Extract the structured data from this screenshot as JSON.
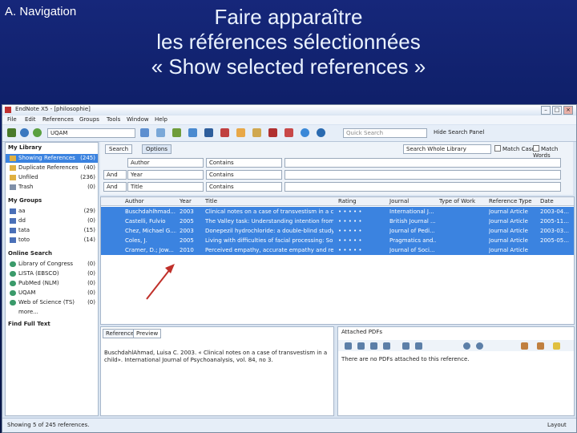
{
  "slide": {
    "section_label": "A. Navigation",
    "title_lines": [
      "Faire apparaître",
      "les références sélectionnées",
      "« Show selected references »"
    ]
  },
  "window": {
    "title": "EndNote X5 - [philosophie]",
    "buttons": [
      "–",
      "□",
      "×"
    ],
    "menu": [
      "File",
      "Edit",
      "References",
      "Groups",
      "Tools",
      "Window",
      "Help"
    ],
    "toolbar": {
      "style_value": "UQAM",
      "group_value": "UQAM",
      "quick_search_placeholder": "Quick Search",
      "hide_search_label": "Hide Search Panel"
    },
    "library": {
      "header": "My Library",
      "items": [
        {
          "label": "Showing References",
          "count": "(245)",
          "selected": true
        },
        {
          "label": "Duplicate References",
          "count": "(40)",
          "selected": false
        },
        {
          "label": "Unfiled",
          "count": "(236)",
          "selected": false
        },
        {
          "label": "Trash",
          "count": "(0)",
          "selected": false
        }
      ],
      "groups_header": "My Groups",
      "groups": [
        {
          "label": "aa",
          "count": "(29)"
        },
        {
          "label": "dd",
          "count": "(0)"
        },
        {
          "label": "tata",
          "count": "(15)"
        },
        {
          "label": "toto",
          "count": "(14)"
        }
      ],
      "online_header": "Online Search",
      "online": [
        {
          "label": "Library of Congress",
          "count": "(0)"
        },
        {
          "label": "LISTA (EBSCO)",
          "count": "(0)"
        },
        {
          "label": "PubMed (NLM)",
          "count": "(0)"
        },
        {
          "label": "UQAM",
          "count": "(0)"
        },
        {
          "label": "Web of Science (TS)",
          "count": "(0)"
        }
      ],
      "more_label": "more...",
      "fulltext_header": "Find Full Text"
    },
    "search": {
      "tabs": [
        "Search",
        "Options"
      ],
      "search_whole": "Search Whole Library",
      "match_case": "Match Case",
      "match_words": "Match Words",
      "rows": [
        {
          "bool": "",
          "field": "Author",
          "op": "Contains"
        },
        {
          "bool": "And",
          "field": "Year",
          "op": "Contains"
        },
        {
          "bool": "And",
          "field": "Title",
          "op": "Contains"
        }
      ]
    },
    "references": {
      "columns": [
        "Author",
        "Year",
        "Title",
        "Rating",
        "Journal",
        "Type of Work",
        "Reference Type",
        "Date"
      ],
      "rows": [
        {
          "author": "Buschdahlhmad...",
          "year": "2003",
          "title": "Clinical notes on a case of transvestism in a child",
          "rating": "• • • • •",
          "journal": "International J...",
          "type": "",
          "reftype": "Journal Article",
          "date": "2003-04..."
        },
        {
          "author": "Castelli, Fulvio",
          "year": "2005",
          "title": "The Valley task: Understanding intention from ...",
          "rating": "• • • • •",
          "journal": "British Journal ...",
          "type": "",
          "reftype": "Journal Article",
          "date": "2005-11..."
        },
        {
          "author": "Chez, Michael G....",
          "year": "2003",
          "title": "Donepezil hydrochloride: a double-blind study ...",
          "rating": "• • • • •",
          "journal": "Journal of Pedi...",
          "type": "",
          "reftype": "Journal Article",
          "date": "2003-03..."
        },
        {
          "author": "Coles, J.",
          "year": "2005",
          "title": "Living with difficulties of facial processing: So...",
          "rating": "• • • • •",
          "journal": "Pragmatics and...",
          "type": "",
          "reftype": "Journal Article",
          "date": "2005-05..."
        },
        {
          "author": "Cramer, D.; Jow...",
          "year": "2010",
          "title": "Perceived empathy, accurate empathy and rel...",
          "rating": "• • • • •",
          "journal": "Journal of Soci...",
          "type": "",
          "reftype": "Journal Article",
          "date": ""
        }
      ]
    },
    "preview": {
      "tabs": [
        "Reference",
        "Preview"
      ],
      "text": "BuschdahlAhmad, Luisa C. 2003. « Clinical notes on a case of transvestism in a child». International Journal of Psychoanalysis, vol. 84, no 3."
    },
    "pdf": {
      "tab": "Attached PDFs",
      "zoom": "",
      "message": "There are no PDFs attached to this reference."
    },
    "status": {
      "left": "Showing 5 of 245 references.",
      "right": "Layout"
    }
  },
  "colors": {
    "selection": "#3b83e0",
    "arrow": "#c0302a"
  }
}
